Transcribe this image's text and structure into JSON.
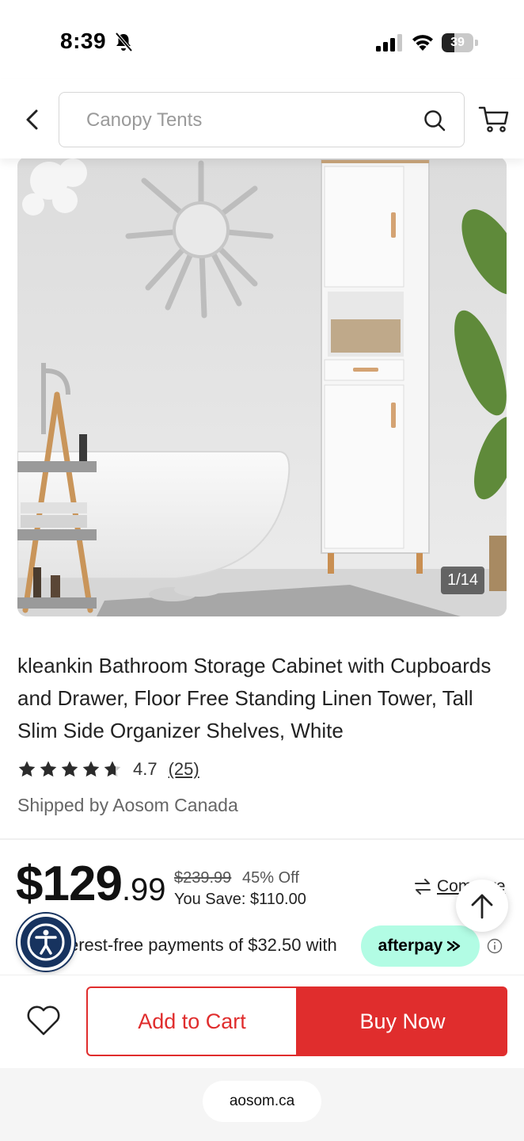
{
  "status_bar": {
    "time": "8:39",
    "battery_level": "39",
    "battery_fraction": 0.39,
    "icons": [
      "bell-slash-icon",
      "cellular-signal-icon",
      "wifi-icon",
      "battery-icon"
    ]
  },
  "header": {
    "back_icon": "chevron-left-icon",
    "search_placeholder": "Canopy Tents",
    "search_icon": "search-icon",
    "cart_icon": "shopping-cart-icon"
  },
  "gallery": {
    "counter": "1/14"
  },
  "product": {
    "title": "kleankin Bathroom Storage Cabinet with Cupboards and Drawer, Floor Free Standing Linen Tower, Tall Slim Side Organizer Shelves, White",
    "rating_value": "4.7",
    "rating_fraction_of_5": 0.94,
    "review_count": "(25)",
    "shipped_by": "Shipped by Aosom Canada"
  },
  "pricing": {
    "price_dollars": "$129",
    "price_cents": ".99",
    "original_price": "$239.99",
    "discount": "45% Off",
    "you_save": "You Save: $110.00",
    "compare_label": "Compare",
    "installments_text": "erest-free payments of $32.50 with",
    "afterpay_label": "afterpay",
    "info_icon": "info-icon"
  },
  "actions": {
    "add_to_cart": "Add to Cart",
    "buy_now": "Buy Now",
    "wishlist_icon": "heart-icon",
    "scroll_top_icon": "arrow-up-icon",
    "accessibility_icon": "accessibility-icon"
  },
  "browser": {
    "url": "aosom.ca"
  },
  "colors": {
    "brand_red": "#e02d2d",
    "afterpay_mint": "#b2fce4",
    "accessibility_navy": "#17335f"
  }
}
